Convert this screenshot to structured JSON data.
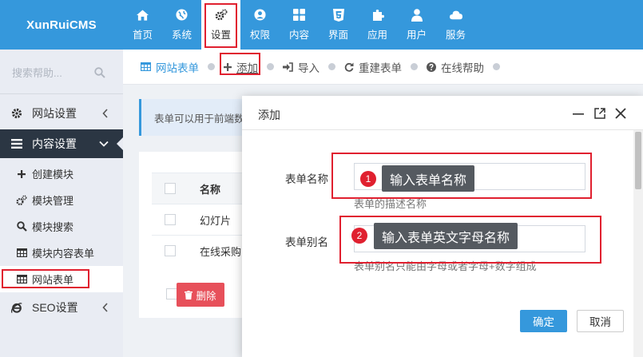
{
  "brand": {
    "name": "XunRuiCMS"
  },
  "nav": [
    {
      "label": "首页",
      "icon": "home-icon"
    },
    {
      "label": "系统",
      "icon": "globe-icon"
    },
    {
      "label": "设置",
      "icon": "cogs-icon",
      "active": true
    },
    {
      "label": "权限",
      "icon": "user-circle-icon"
    },
    {
      "label": "内容",
      "icon": "grid-icon"
    },
    {
      "label": "界面",
      "icon": "html5-icon"
    },
    {
      "label": "应用",
      "icon": "puzzle-icon"
    },
    {
      "label": "用户",
      "icon": "user-icon"
    },
    {
      "label": "服务",
      "icon": "cloud-icon"
    }
  ],
  "sidebar": {
    "search_placeholder": "搜索帮助...",
    "menus": [
      {
        "label": "网站设置",
        "icon": "gear-icon"
      },
      {
        "label": "内容设置",
        "icon": "bars-icon"
      },
      {
        "label": "SEO设置",
        "icon": "ie-icon"
      }
    ],
    "submenu": [
      {
        "label": "创建模块",
        "icon": "plus-icon"
      },
      {
        "label": "模块管理",
        "icon": "cogs-icon"
      },
      {
        "label": "模块搜索",
        "icon": "search-icon"
      },
      {
        "label": "模块内容表单",
        "icon": "table-icon"
      },
      {
        "label": "网站表单",
        "icon": "table-icon"
      }
    ]
  },
  "breadcrumb": [
    {
      "label": "网站表单",
      "icon": "table-icon"
    },
    {
      "label": "添加",
      "icon": "plus-icon"
    },
    {
      "label": "导入",
      "icon": "sign-in-icon"
    },
    {
      "label": "重建表单",
      "icon": "refresh-icon"
    },
    {
      "label": "在线帮助",
      "icon": "question-icon"
    }
  ],
  "note": "表单可以用于前端数",
  "table": {
    "header": "名称",
    "rows": [
      "幻灯片",
      "在线采购"
    ]
  },
  "delete_label": "删除",
  "modal": {
    "title": "添加",
    "fields": [
      {
        "label": "表单名称",
        "help": "表单的描述名称",
        "tip": "输入表单名称",
        "num": "1"
      },
      {
        "label": "表单别名",
        "help": "表单别名只能由字母或者字母+数字组成",
        "tip": "输入表单英文字母名称",
        "num": "2"
      }
    ],
    "ok": "确定",
    "cancel": "取消"
  },
  "colors": {
    "primary": "#3598dc",
    "highlight": "#e0202f",
    "sidebar_dark": "#2b3643",
    "danger": "#e7505a"
  }
}
